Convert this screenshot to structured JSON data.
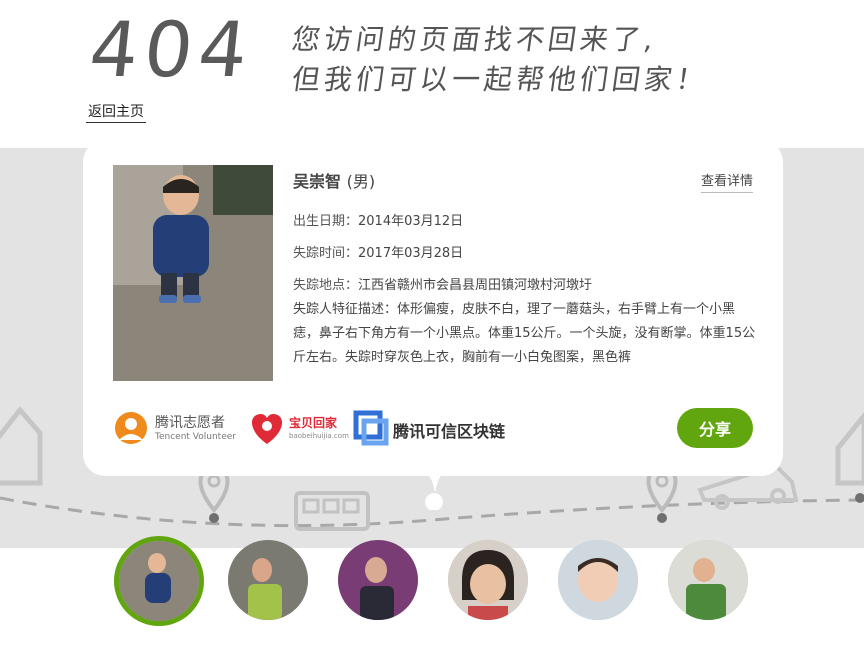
{
  "header": {
    "code": "404",
    "headline_line1": "您访问的页面找不回来了,",
    "headline_line2": "但我们可以一起帮他们回家！",
    "home_link": "返回主页"
  },
  "card": {
    "name": "吴崇智",
    "gender": "(男)",
    "detail_link": "查看详情",
    "fields": [
      {
        "key": "出生日期：",
        "value": "2014年03月12日"
      },
      {
        "key": "失踪时间：",
        "value": "2017年03月28日"
      },
      {
        "key": "失踪地点：",
        "value": "江西省赣州市会昌县周田镇河墩村河墩圩"
      }
    ],
    "description_key": "失踪人特征描述：",
    "description": "体形偏瘦，皮肤不白，理了一蘑菇头，右手臂上有一个小黑痣，鼻子右下角方有一个小黑点。体重15公斤。一个头旋，没有断掌。体重15公斤左右。失踪时穿灰色上衣，胸前有一小白兔图案，黑色裤",
    "share_label": "分享"
  },
  "logos": {
    "tencent_volunteer_cn": "腾讯志愿者",
    "tencent_volunteer_en": "Tencent Volunteer",
    "baobei_cn": "宝贝回家",
    "baobei_url": "baobeihuijia.com",
    "blockchain": "腾讯可信区块链"
  },
  "colors": {
    "accent": "#62a60f",
    "band": "#e3e3e3",
    "tencent_orange": "#f08a1c",
    "baobei_red": "#e02a37",
    "blockchain_blue": "#2f6fd6"
  },
  "thumbnails": [
    {
      "label": "child-1",
      "active": true
    },
    {
      "label": "child-2",
      "active": false
    },
    {
      "label": "child-3",
      "active": false
    },
    {
      "label": "child-4",
      "active": false
    },
    {
      "label": "child-5",
      "active": false
    },
    {
      "label": "child-6",
      "active": false
    }
  ]
}
